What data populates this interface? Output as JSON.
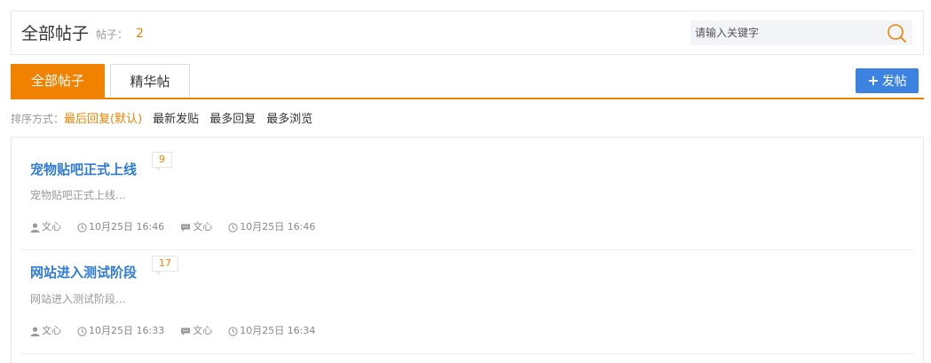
{
  "header": {
    "title": "全部帖子",
    "count_label": "帖子：",
    "count": "2",
    "search_placeholder": "请输入关键字",
    "search_icon": "search-icon"
  },
  "tabs": [
    {
      "label": "全部帖子",
      "active": true
    },
    {
      "label": "精华帖",
      "active": false
    }
  ],
  "post_button": {
    "icon": "plus-icon",
    "label": "发帖"
  },
  "sort": {
    "label": "排序方式：",
    "options": [
      "最后回复(默认)",
      "最新发贴",
      "最多回复",
      "最多浏览"
    ],
    "active": "最后回复(默认)"
  },
  "posts": [
    {
      "title": "宠物贴吧正式上线",
      "replies": "9",
      "excerpt": "宠物贴吧正式上线...",
      "author": "文心",
      "created": "10月25日 16:46",
      "last_replier": "文心",
      "last_reply_time": "10月25日 16:46"
    },
    {
      "title": "网站进入测试阶段",
      "replies": "17",
      "excerpt": "网站进入测试阶段...",
      "author": "文心",
      "created": "10月25日 16:33",
      "last_replier": "文心",
      "last_reply_time": "10月25日 16:34"
    }
  ],
  "colors": {
    "accent": "#f08200",
    "link": "#2e7bd6",
    "primary_button": "#3c82e1"
  }
}
